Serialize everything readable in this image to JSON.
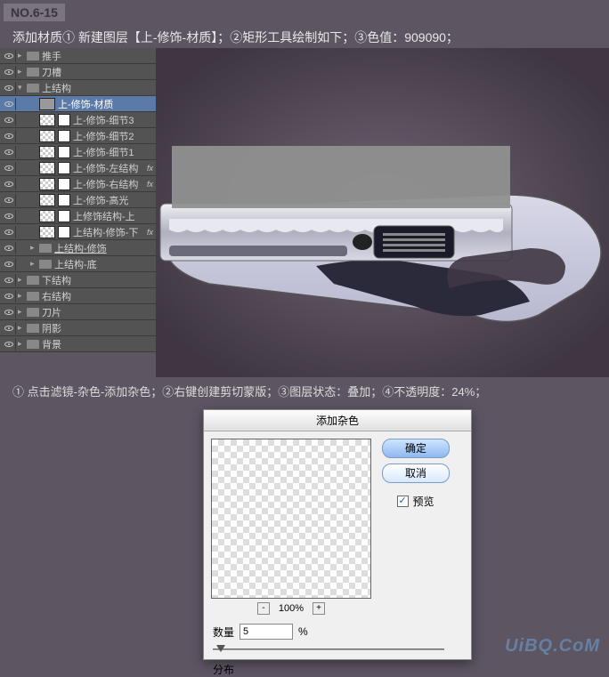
{
  "step_badge": "NO.6-15",
  "instruction1": "添加材质① 新建图层【上-修饰-材质】；②矩形工具绘制如下；③色值：909090；",
  "instruction2": "① 点击滤镜-杂色-添加杂色；②右键创建剪切蒙版；③图层状态：叠加；④不透明度：24%；",
  "layers": [
    {
      "type": "folder",
      "label": "推手",
      "indent": 0,
      "open": false
    },
    {
      "type": "folder",
      "label": "刀槽",
      "indent": 0,
      "open": false
    },
    {
      "type": "folder",
      "label": "上结构",
      "indent": 0,
      "open": true
    },
    {
      "type": "layer",
      "label": "上-修饰-材质",
      "indent": 1,
      "selected": true,
      "thumb": "gray"
    },
    {
      "type": "layer",
      "label": "上-修饰-细节3",
      "indent": 1,
      "thumb": "checker",
      "mask": true
    },
    {
      "type": "layer",
      "label": "上-修饰-细节2",
      "indent": 1,
      "thumb": "checker",
      "mask": true
    },
    {
      "type": "layer",
      "label": "上-修饰-细节1",
      "indent": 1,
      "thumb": "checker",
      "mask": true
    },
    {
      "type": "layer",
      "label": "上-修饰-左结构",
      "indent": 1,
      "thumb": "checker",
      "mask": true,
      "fx": true
    },
    {
      "type": "layer",
      "label": "上-修饰-右结构",
      "indent": 1,
      "thumb": "checker",
      "mask": true,
      "fx": true
    },
    {
      "type": "layer",
      "label": "上-修饰-高光",
      "indent": 1,
      "thumb": "checker",
      "mask": true
    },
    {
      "type": "layer",
      "label": "上修饰结构-上",
      "indent": 1,
      "thumb": "checker",
      "mask": true
    },
    {
      "type": "layer",
      "label": "上结构-修饰-下",
      "indent": 1,
      "thumb": "checker",
      "mask": true,
      "fx": true
    },
    {
      "type": "folder",
      "label": "上结构-修饰",
      "indent": 1,
      "open": false,
      "underline": true
    },
    {
      "type": "folder",
      "label": "上结构-底",
      "indent": 1,
      "open": false
    },
    {
      "type": "folder",
      "label": "下结构",
      "indent": 0,
      "open": false
    },
    {
      "type": "folder",
      "label": "右结构",
      "indent": 0,
      "open": false
    },
    {
      "type": "folder",
      "label": "刀片",
      "indent": 0,
      "open": false
    },
    {
      "type": "folder",
      "label": "阴影",
      "indent": 0,
      "open": false
    },
    {
      "type": "folder",
      "label": "背景",
      "indent": 0,
      "open": false
    }
  ],
  "dialog": {
    "title": "添加杂色",
    "ok": "确定",
    "cancel": "取消",
    "preview_label": "预览",
    "zoom": "100%",
    "amount_label": "数量",
    "amount_unit": "%",
    "amount_value": "5",
    "distribution": "分布"
  },
  "watermark": "UiBQ.CoM"
}
